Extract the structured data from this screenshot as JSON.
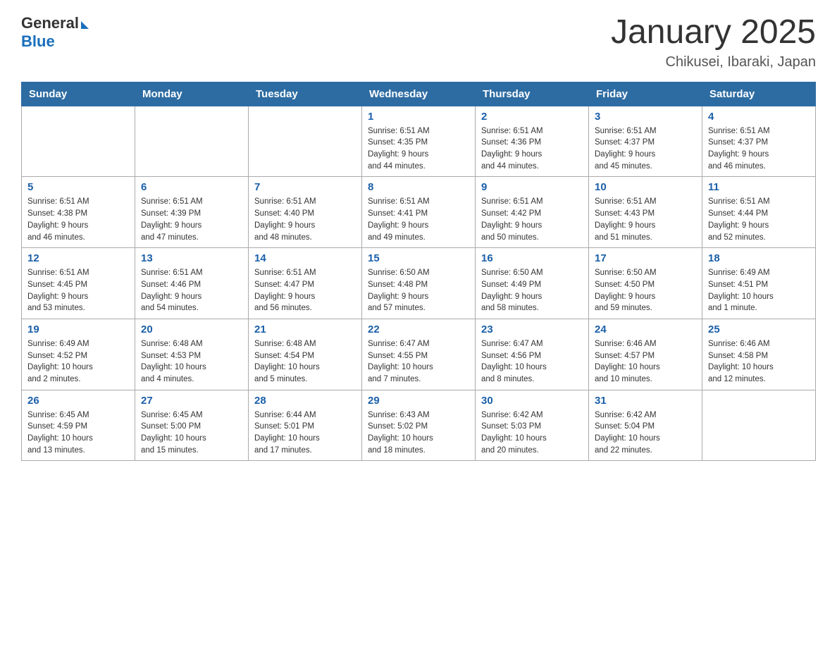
{
  "header": {
    "logo_general": "General",
    "logo_blue": "Blue",
    "title": "January 2025",
    "subtitle": "Chikusei, Ibaraki, Japan"
  },
  "weekdays": [
    "Sunday",
    "Monday",
    "Tuesday",
    "Wednesday",
    "Thursday",
    "Friday",
    "Saturday"
  ],
  "weeks": [
    [
      {
        "day": "",
        "info": ""
      },
      {
        "day": "",
        "info": ""
      },
      {
        "day": "",
        "info": ""
      },
      {
        "day": "1",
        "info": "Sunrise: 6:51 AM\nSunset: 4:35 PM\nDaylight: 9 hours\nand 44 minutes."
      },
      {
        "day": "2",
        "info": "Sunrise: 6:51 AM\nSunset: 4:36 PM\nDaylight: 9 hours\nand 44 minutes."
      },
      {
        "day": "3",
        "info": "Sunrise: 6:51 AM\nSunset: 4:37 PM\nDaylight: 9 hours\nand 45 minutes."
      },
      {
        "day": "4",
        "info": "Sunrise: 6:51 AM\nSunset: 4:37 PM\nDaylight: 9 hours\nand 46 minutes."
      }
    ],
    [
      {
        "day": "5",
        "info": "Sunrise: 6:51 AM\nSunset: 4:38 PM\nDaylight: 9 hours\nand 46 minutes."
      },
      {
        "day": "6",
        "info": "Sunrise: 6:51 AM\nSunset: 4:39 PM\nDaylight: 9 hours\nand 47 minutes."
      },
      {
        "day": "7",
        "info": "Sunrise: 6:51 AM\nSunset: 4:40 PM\nDaylight: 9 hours\nand 48 minutes."
      },
      {
        "day": "8",
        "info": "Sunrise: 6:51 AM\nSunset: 4:41 PM\nDaylight: 9 hours\nand 49 minutes."
      },
      {
        "day": "9",
        "info": "Sunrise: 6:51 AM\nSunset: 4:42 PM\nDaylight: 9 hours\nand 50 minutes."
      },
      {
        "day": "10",
        "info": "Sunrise: 6:51 AM\nSunset: 4:43 PM\nDaylight: 9 hours\nand 51 minutes."
      },
      {
        "day": "11",
        "info": "Sunrise: 6:51 AM\nSunset: 4:44 PM\nDaylight: 9 hours\nand 52 minutes."
      }
    ],
    [
      {
        "day": "12",
        "info": "Sunrise: 6:51 AM\nSunset: 4:45 PM\nDaylight: 9 hours\nand 53 minutes."
      },
      {
        "day": "13",
        "info": "Sunrise: 6:51 AM\nSunset: 4:46 PM\nDaylight: 9 hours\nand 54 minutes."
      },
      {
        "day": "14",
        "info": "Sunrise: 6:51 AM\nSunset: 4:47 PM\nDaylight: 9 hours\nand 56 minutes."
      },
      {
        "day": "15",
        "info": "Sunrise: 6:50 AM\nSunset: 4:48 PM\nDaylight: 9 hours\nand 57 minutes."
      },
      {
        "day": "16",
        "info": "Sunrise: 6:50 AM\nSunset: 4:49 PM\nDaylight: 9 hours\nand 58 minutes."
      },
      {
        "day": "17",
        "info": "Sunrise: 6:50 AM\nSunset: 4:50 PM\nDaylight: 9 hours\nand 59 minutes."
      },
      {
        "day": "18",
        "info": "Sunrise: 6:49 AM\nSunset: 4:51 PM\nDaylight: 10 hours\nand 1 minute."
      }
    ],
    [
      {
        "day": "19",
        "info": "Sunrise: 6:49 AM\nSunset: 4:52 PM\nDaylight: 10 hours\nand 2 minutes."
      },
      {
        "day": "20",
        "info": "Sunrise: 6:48 AM\nSunset: 4:53 PM\nDaylight: 10 hours\nand 4 minutes."
      },
      {
        "day": "21",
        "info": "Sunrise: 6:48 AM\nSunset: 4:54 PM\nDaylight: 10 hours\nand 5 minutes."
      },
      {
        "day": "22",
        "info": "Sunrise: 6:47 AM\nSunset: 4:55 PM\nDaylight: 10 hours\nand 7 minutes."
      },
      {
        "day": "23",
        "info": "Sunrise: 6:47 AM\nSunset: 4:56 PM\nDaylight: 10 hours\nand 8 minutes."
      },
      {
        "day": "24",
        "info": "Sunrise: 6:46 AM\nSunset: 4:57 PM\nDaylight: 10 hours\nand 10 minutes."
      },
      {
        "day": "25",
        "info": "Sunrise: 6:46 AM\nSunset: 4:58 PM\nDaylight: 10 hours\nand 12 minutes."
      }
    ],
    [
      {
        "day": "26",
        "info": "Sunrise: 6:45 AM\nSunset: 4:59 PM\nDaylight: 10 hours\nand 13 minutes."
      },
      {
        "day": "27",
        "info": "Sunrise: 6:45 AM\nSunset: 5:00 PM\nDaylight: 10 hours\nand 15 minutes."
      },
      {
        "day": "28",
        "info": "Sunrise: 6:44 AM\nSunset: 5:01 PM\nDaylight: 10 hours\nand 17 minutes."
      },
      {
        "day": "29",
        "info": "Sunrise: 6:43 AM\nSunset: 5:02 PM\nDaylight: 10 hours\nand 18 minutes."
      },
      {
        "day": "30",
        "info": "Sunrise: 6:42 AM\nSunset: 5:03 PM\nDaylight: 10 hours\nand 20 minutes."
      },
      {
        "day": "31",
        "info": "Sunrise: 6:42 AM\nSunset: 5:04 PM\nDaylight: 10 hours\nand 22 minutes."
      },
      {
        "day": "",
        "info": ""
      }
    ]
  ]
}
